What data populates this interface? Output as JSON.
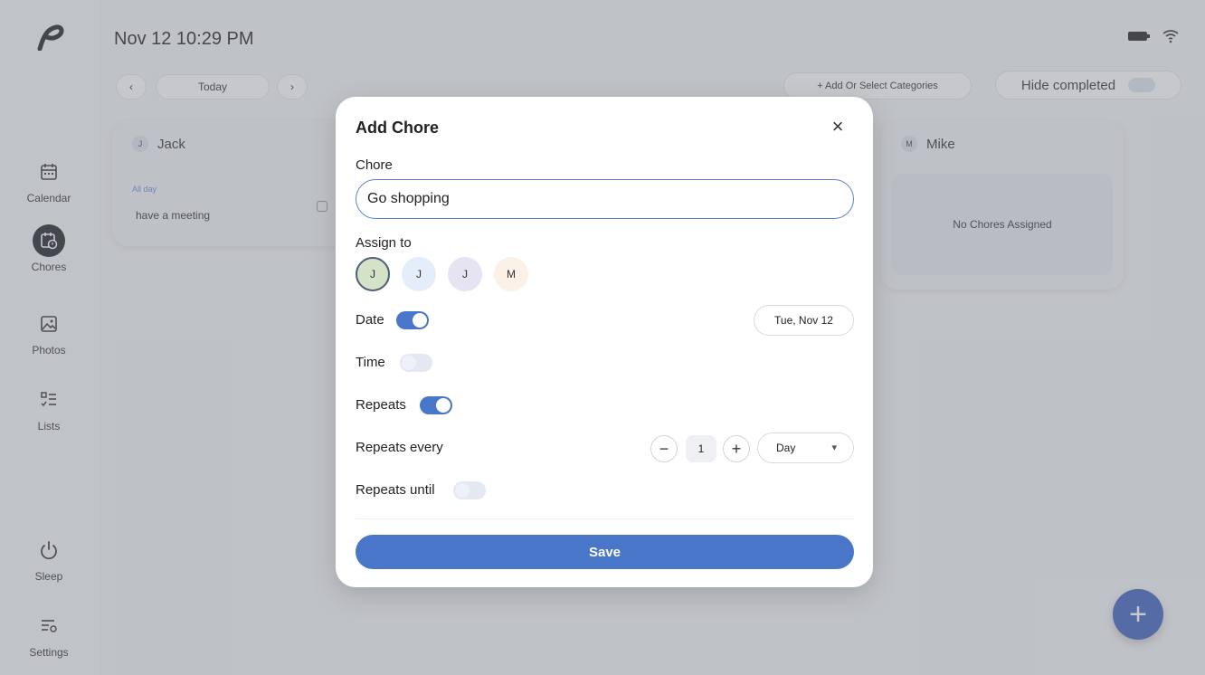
{
  "topbar": {
    "datetime": "Nov 12 10:29 PM"
  },
  "sidebar": {
    "items": [
      {
        "label": "Calendar",
        "icon": "calendar-icon"
      },
      {
        "label": "Chores",
        "icon": "chores-icon"
      },
      {
        "label": "Photos",
        "icon": "photos-icon"
      },
      {
        "label": "Lists",
        "icon": "lists-icon"
      },
      {
        "label": "Sleep",
        "icon": "power-icon"
      },
      {
        "label": "Settings",
        "icon": "settings-icon"
      }
    ]
  },
  "toolbar": {
    "prev": "‹",
    "today": "Today",
    "next": "›",
    "add_categories": "+ Add Or Select Categories",
    "hide_completed": "Hide completed"
  },
  "columns": [
    {
      "initial": "J",
      "name": "Jack",
      "tag": "All day",
      "task": "have a meeting"
    },
    {
      "initial": "M",
      "name": "Mike",
      "empty": "No Chores Assigned"
    }
  ],
  "modal": {
    "title": "Add Chore",
    "close": "×",
    "chore_label": "Chore",
    "chore_value": "Go shopping",
    "assign_label": "Assign to",
    "assignees": [
      "J",
      "J",
      "J",
      "M"
    ],
    "date_label": "Date",
    "date_value": "Tue, Nov 12",
    "time_label": "Time",
    "repeats_label": "Repeats",
    "repeats_every_label": "Repeats every",
    "minus": "−",
    "interval": "1",
    "plus": "+",
    "unit": "Day",
    "repeats_until_label": "Repeats until",
    "save": "Save"
  },
  "fab": "+",
  "colors": {
    "accent": "#4a76c9",
    "fab": "#3b5fc0"
  }
}
